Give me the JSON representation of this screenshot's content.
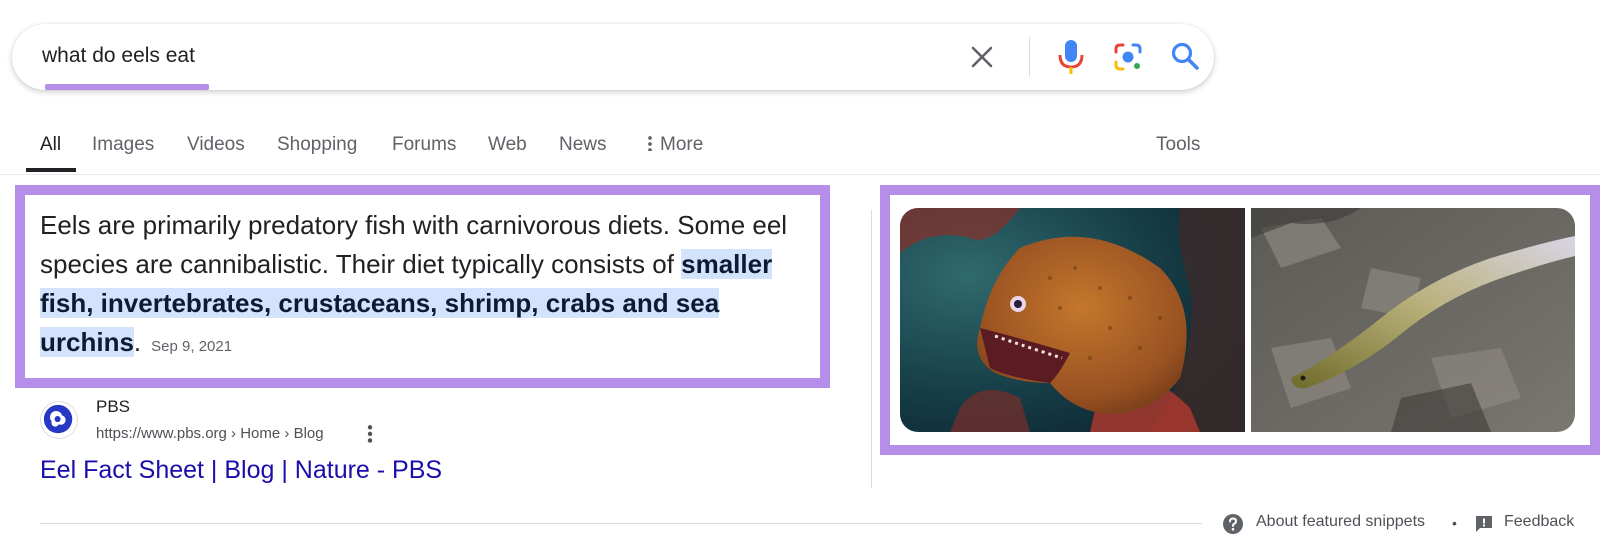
{
  "search": {
    "query": "what do eels eat",
    "icons": [
      "clear-icon",
      "microphone-icon",
      "lens-camera-icon",
      "search-icon"
    ]
  },
  "tabs": [
    {
      "label": "All",
      "active": true
    },
    {
      "label": "Images"
    },
    {
      "label": "Videos"
    },
    {
      "label": "Shopping"
    },
    {
      "label": "Forums"
    },
    {
      "label": "Web"
    },
    {
      "label": "News"
    },
    {
      "label": "More"
    }
  ],
  "tools_label": "Tools",
  "snippet": {
    "text_plain": "Eels are primarily predatory fish with carnivorous diets. Some eel species are cannibalistic. Their diet typically consists of ",
    "text_highlight": "smaller fish, invertebrates, crustaceans, shrimp, crabs and sea urchins",
    "text_after": ".",
    "date": "Sep 9, 2021",
    "highlight_color": "#d3e3fd"
  },
  "source": {
    "name": "PBS",
    "url": "https://www.pbs.org › Home › Blog",
    "title": "Eel Fact Sheet | Blog | Nature - PBS",
    "logo_icon": "pbs-logo-icon"
  },
  "images": [
    {
      "name": "moray-eel-image"
    },
    {
      "name": "freshwater-eel-image"
    }
  ],
  "footer": {
    "about_label": "About featured snippets",
    "separator": "•",
    "feedback_label": "Feedback"
  },
  "colors": {
    "annotation_border": "#b48ee8",
    "link": "#1a0dab",
    "text": "#202124",
    "muted": "#5f6368"
  }
}
